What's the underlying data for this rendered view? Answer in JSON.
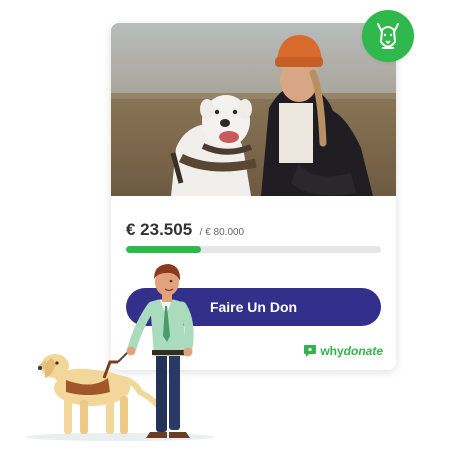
{
  "campaign": {
    "raised": "€ 23.505",
    "goal": "/ € 80.000",
    "progress_percent": 29.4
  },
  "donate_button": {
    "label": "Faire Un Don"
  },
  "brand": {
    "why": "why",
    "donate": "donate",
    "icon": "chat-bubble-icon"
  },
  "badge": {
    "icon": "dog-icon"
  },
  "colors": {
    "accent_green": "#2fb84b",
    "button_blue": "#33308c",
    "track_gray": "#e6e6e6"
  }
}
